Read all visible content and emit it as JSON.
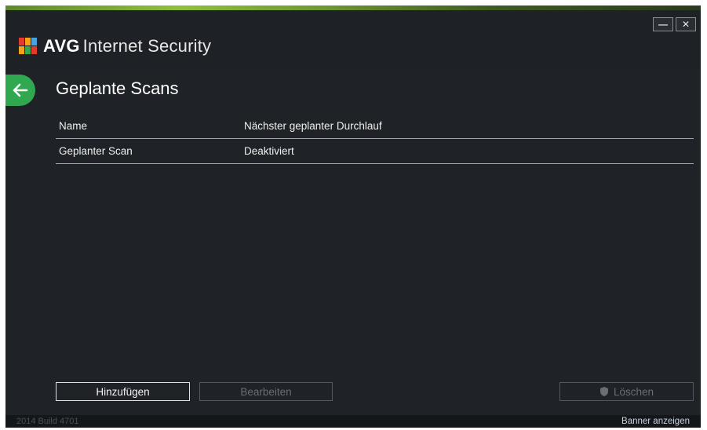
{
  "window": {
    "brand": "AVG",
    "product": "Internet Security",
    "minimize_label": "—",
    "close_label": "✕",
    "accent_color": "#2fa84f"
  },
  "navigation": {
    "back_icon": "arrow-left-icon"
  },
  "page": {
    "title": "Geplante Scans"
  },
  "table": {
    "columns": [
      "Name",
      "Nächster geplanter Durchlauf"
    ],
    "rows": [
      [
        "Geplanter Scan",
        "Deaktiviert"
      ]
    ]
  },
  "actions": {
    "add_label": "Hinzufügen",
    "edit_label": "Bearbeiten",
    "delete_label": "Löschen",
    "delete_icon": "shield-icon"
  },
  "status": {
    "build": "2014  Build 4701",
    "banner_link": "Banner anzeigen"
  }
}
